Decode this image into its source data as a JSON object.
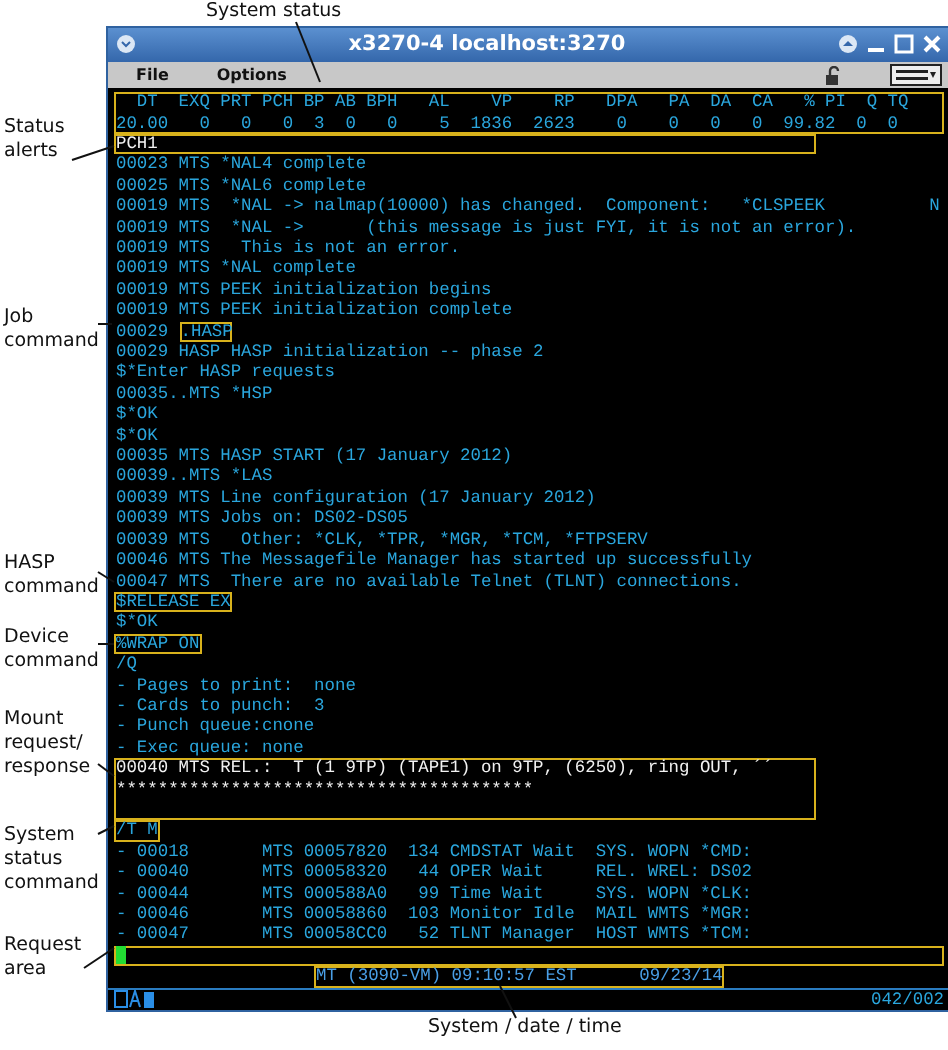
{
  "annotations": [
    {
      "text": "System status"
    },
    {
      "text": "Status\nalerts"
    },
    {
      "text": "Job\ncommand"
    },
    {
      "text": "HASP\ncommand"
    },
    {
      "text": "Device\ncommand"
    },
    {
      "text": "Mount\nrequest/\nresponse"
    },
    {
      "text": "System\nstatus\ncommand"
    },
    {
      "text": "Request\narea"
    },
    {
      "text": "System / date / time"
    }
  ],
  "window": {
    "title": "x3270-4 localhost:3270",
    "menu": [
      "File",
      "Options"
    ]
  },
  "terminal": {
    "rows": [
      {
        "kind": "header",
        "boxed": true,
        "text": "  DT  EXQ PRT PCH BP AB BPH   AL    VP    RP   DPA   PA  DA  CA   % PI  Q TQ\n20.00   0   0   0  3  0   0    5  1836  2623    0    0   0   0  99.82  0  0"
      },
      {
        "kind": "alert",
        "boxed": true,
        "text": "PCH1"
      },
      {
        "kind": "message",
        "boxed": false,
        "text": "00023 MTS *NAL4 complete"
      },
      {
        "kind": "message",
        "boxed": false,
        "text": "00025 MTS *NAL6 complete"
      },
      {
        "kind": "message",
        "boxed": false,
        "text": "00019 MTS  *NAL -> nalmap(10000) has changed.  Component:   *CLSPEEK          N"
      },
      {
        "kind": "message",
        "boxed": false,
        "text": "00019 MTS  *NAL ->      (this message is just FYI, it is not an error)."
      },
      {
        "kind": "message",
        "boxed": false,
        "text": "00019 MTS   This is not an error."
      },
      {
        "kind": "message",
        "boxed": false,
        "text": "00019 MTS *NAL complete"
      },
      {
        "kind": "message",
        "boxed": false,
        "text": "00019 MTS PEEK initialization begins"
      },
      {
        "kind": "message",
        "boxed": false,
        "text": "00019 MTS PEEK initialization complete"
      },
      {
        "kind": "message",
        "boxed": false,
        "text": "00029",
        "marked": ".HASP"
      },
      {
        "kind": "message",
        "boxed": false,
        "text": "00029 HASP HASP initialization -- phase 2"
      },
      {
        "kind": "message",
        "boxed": false,
        "text": "$*Enter HASP requests"
      },
      {
        "kind": "message",
        "boxed": false,
        "text": "00035..MTS *HSP"
      },
      {
        "kind": "message",
        "boxed": false,
        "text": "$*OK"
      },
      {
        "kind": "message",
        "boxed": false,
        "text": "$*OK"
      },
      {
        "kind": "message",
        "boxed": false,
        "text": "00035 MTS HASP START (17 January 2012)"
      },
      {
        "kind": "message",
        "boxed": false,
        "text": "00039..MTS *LAS"
      },
      {
        "kind": "message",
        "boxed": false,
        "text": "00039 MTS Line configuration (17 January 2012)"
      },
      {
        "kind": "message",
        "boxed": false,
        "text": "00039 MTS Jobs on: DS02-DS05"
      },
      {
        "kind": "message",
        "boxed": false,
        "text": "00039 MTS   Other: *CLK, *TPR, *MGR, *TCM, *FTPSERV"
      },
      {
        "kind": "message",
        "boxed": false,
        "text": "00046 MTS The Messagefile Manager has started up successfully"
      },
      {
        "kind": "message",
        "boxed": false,
        "text": "00047 MTS  There are no available Telnet (TLNT) connections."
      },
      {
        "kind": "message",
        "boxed": true,
        "text": "$RELEASE EX"
      },
      {
        "kind": "message",
        "boxed": false,
        "text": "$*OK"
      },
      {
        "kind": "message",
        "boxed": true,
        "text": "%WRAP ON"
      },
      {
        "kind": "message",
        "boxed": false,
        "text": "/Q"
      },
      {
        "kind": "message",
        "boxed": false,
        "text": "- Pages to print:  none"
      },
      {
        "kind": "message",
        "boxed": false,
        "text": "- Cards to punch:  3"
      },
      {
        "kind": "message",
        "boxed": false,
        "text": "- Punch queue:cnone"
      },
      {
        "kind": "message",
        "boxed": false,
        "text": "- Exec queue: none"
      },
      {
        "kind": "alert",
        "boxed": true,
        "text": "00040 MTS REL.:  T (1 9TP) (TAPE1) on 9TP, (6250), ring OUT, ´´\n****************************************\n"
      },
      {
        "kind": "message",
        "boxed": true,
        "text": "/T M"
      },
      {
        "kind": "message",
        "boxed": false,
        "text": "- 00018       MTS 00057820  134 CMDSTAT Wait  SYS. WOPN *CMD:"
      },
      {
        "kind": "message",
        "boxed": false,
        "text": "- 00040       MTS 00058320   44 OPER Wait     REL. WREL: DS02"
      },
      {
        "kind": "message",
        "boxed": false,
        "text": "- 00044       MTS 000588A0   99 Time Wait     SYS. WOPN *CLK:"
      },
      {
        "kind": "message",
        "boxed": false,
        "text": "- 00046       MTS 00058860  103 Monitor Idle  MAIL WMTS *MGR:"
      },
      {
        "kind": "message",
        "boxed": false,
        "text": "- 00047       MTS 00058CC0   52 TLNT Manager  HOST WMTS *TCM:"
      },
      {
        "kind": "input",
        "boxed": true,
        "text": ""
      },
      {
        "kind": "clock",
        "boxed": true,
        "text": "MT (3090-VM) 09:10:57 EST      09/23/14"
      }
    ]
  },
  "status_bar": {
    "cursor_position": "042/002"
  }
}
